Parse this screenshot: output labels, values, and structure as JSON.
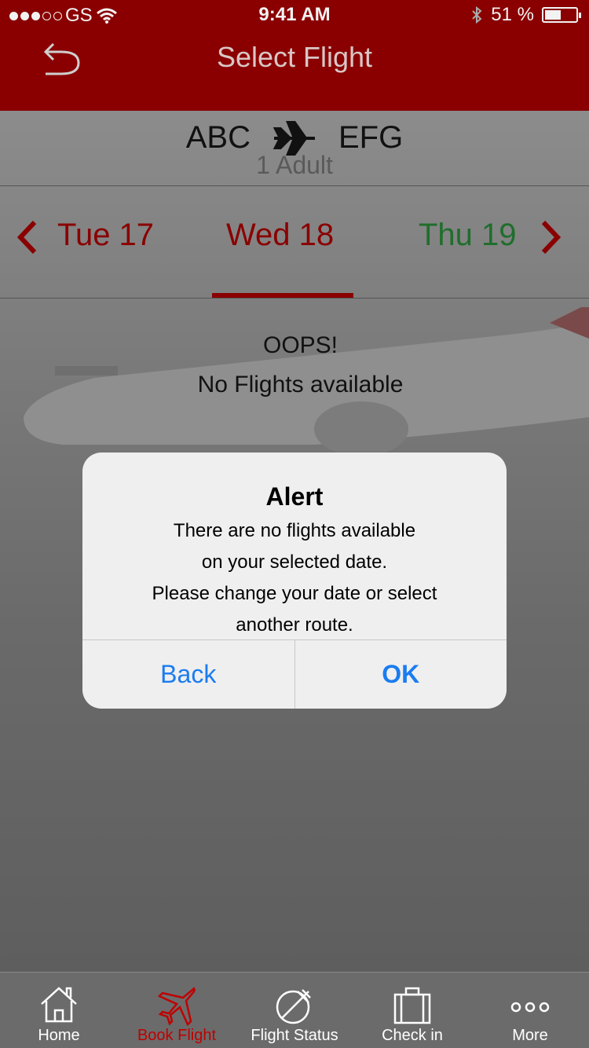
{
  "status_bar": {
    "carrier": "GS",
    "time": "9:41 AM",
    "battery": "51 %"
  },
  "nav": {
    "title": "Select Flight"
  },
  "route": {
    "origin": "ABC",
    "destination": "EFG",
    "passengers": "1 Adult"
  },
  "dates": {
    "prev": "Tue 17",
    "current": "Wed 18",
    "next": "Thu 19"
  },
  "results": {
    "heading": "OOPS!",
    "message": "No Flights available"
  },
  "alert": {
    "title": "Alert",
    "line1": "There are no flights available",
    "line2": "on your selected date.",
    "line3": "Please change your date or select",
    "line4": "another route.",
    "back_label": "Back",
    "ok_label": "OK"
  },
  "tabs": [
    {
      "label": "Home",
      "icon": "home-icon"
    },
    {
      "label": "Book Flight",
      "icon": "airplane-icon"
    },
    {
      "label": "Flight Status",
      "icon": "globe-plane-icon"
    },
    {
      "label": "Check in",
      "icon": "suitcase-icon"
    },
    {
      "label": "More",
      "icon": "more-dots-icon"
    }
  ],
  "colors": {
    "brand_red": "#8a0000",
    "next_date_green": "#1f6e2c",
    "ios_blue": "#1a7cf0"
  }
}
